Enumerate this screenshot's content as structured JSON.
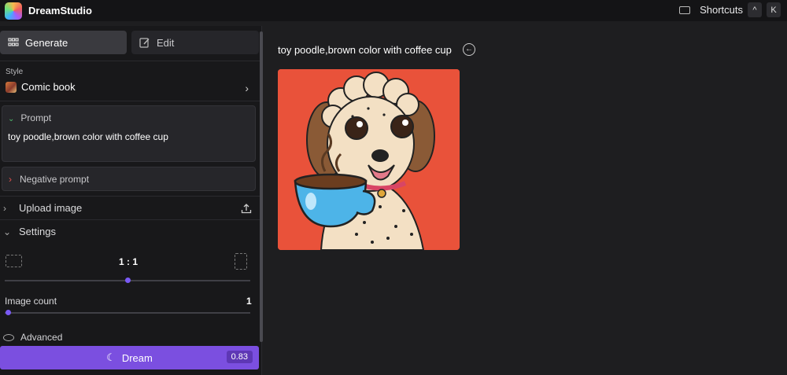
{
  "app": {
    "title": "DreamStudio"
  },
  "header": {
    "shortcuts_label": "Shortcuts",
    "key1": "^",
    "key2": "K"
  },
  "tabs": [
    {
      "label": "Generate",
      "active": true
    },
    {
      "label": "Edit",
      "active": false
    }
  ],
  "style": {
    "label": "Style",
    "value": "Comic book"
  },
  "prompt": {
    "label": "Prompt",
    "value": "toy poodle,brown color with coffee cup"
  },
  "negative_prompt": {
    "label": "Negative prompt"
  },
  "upload": {
    "label": "Upload image"
  },
  "settings": {
    "label": "Settings",
    "aspect_ratio": "1 : 1",
    "aspect_slider_fraction": 0.5,
    "image_count_label": "Image count",
    "image_count_value": "1",
    "image_count_fraction": 0.0,
    "advanced_label": "Advanced"
  },
  "dream": {
    "label": "Dream",
    "credits": "0.83"
  },
  "result": {
    "title": "toy poodle,brown color with coffee cup"
  },
  "colors": {
    "accent": "#7b4fe0",
    "image_background": "#e9523a"
  }
}
